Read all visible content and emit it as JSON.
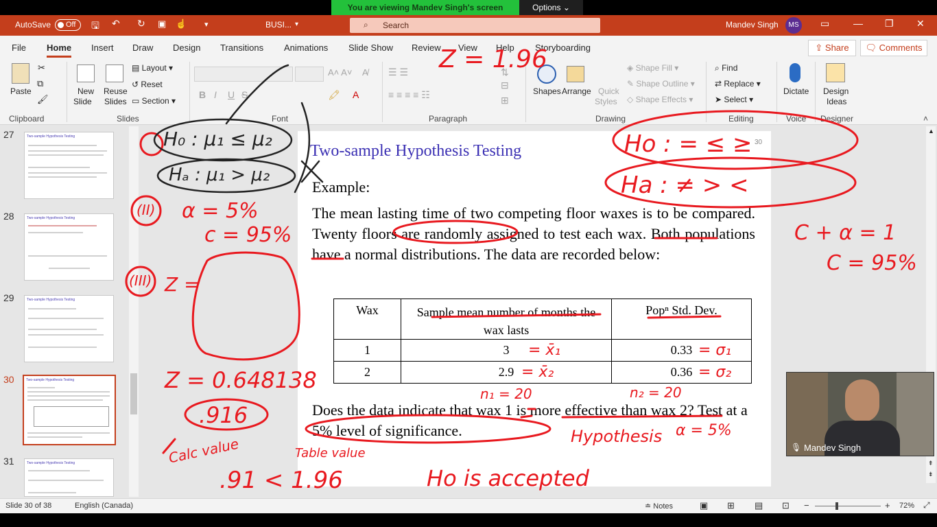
{
  "zoom": {
    "viewing_text": "You are viewing Mandev Singh's screen",
    "options_label": "Options"
  },
  "titlebar": {
    "autosave_label": "AutoSave",
    "autosave_state": "Off",
    "filename": "BUSI...",
    "search_placeholder": "Search",
    "user_name": "Mandev Singh",
    "user_initials": "MS"
  },
  "menu": {
    "tabs": [
      "File",
      "Home",
      "Insert",
      "Draw",
      "Design",
      "Transitions",
      "Animations",
      "Slide Show",
      "Review",
      "View",
      "Help",
      "Storyboarding"
    ],
    "share_label": "Share",
    "comments_label": "Comments"
  },
  "ribbon": {
    "clipboard": {
      "paste": "Paste",
      "group": "Clipboard"
    },
    "slides": {
      "new_slide_1": "New",
      "new_slide_2": "Slide",
      "reuse_1": "Reuse",
      "reuse_2": "Slides",
      "layout": "Layout",
      "reset": "Reset",
      "section": "Section",
      "group": "Slides"
    },
    "font": {
      "group": "Font",
      "bold": "B",
      "italic": "I",
      "underline": "U",
      "strike": "S"
    },
    "paragraph": {
      "group": "Paragraph"
    },
    "drawing": {
      "shapes": "Shapes",
      "arrange": "Arrange",
      "quick_1": "Quick",
      "quick_2": "Styles",
      "shape_fill": "Shape Fill",
      "shape_outline": "Shape Outline",
      "shape_effects": "Shape Effects",
      "group": "Drawing"
    },
    "editing": {
      "find": "Find",
      "replace": "Replace",
      "select": "Select",
      "group": "Editing"
    },
    "voice": {
      "dictate": "Dictate",
      "group": "Voice"
    },
    "designer": {
      "ideas_1": "Design",
      "ideas_2": "Ideas",
      "group": "Designer"
    }
  },
  "thumbnails": [
    {
      "num": "27",
      "title": "Two-sample Hypothesis Testing"
    },
    {
      "num": "28",
      "title": "Two-sample Hypothesis Testing"
    },
    {
      "num": "29",
      "title": "Two-sample Hypothesis Testing"
    },
    {
      "num": "30",
      "title": "Two-sample Hypothesis Testing"
    },
    {
      "num": "31",
      "title": "Two-sample Hypothesis Testing"
    }
  ],
  "slide": {
    "number": "30",
    "title": "Two-sample Hypothesis Testing",
    "example_label": "Example:",
    "paragraph": "The mean lasting time of two competing floor waxes is to be compared. Twenty floors are randomly assigned to test each wax. Both populations have a normal distributions. The data are recorded below:",
    "table": {
      "headers": [
        "Wax",
        "Sample mean number of months the wax lasts",
        "Popⁿ Std. Dev."
      ],
      "rows": [
        [
          "1",
          "3",
          "0.33"
        ],
        [
          "2",
          "2.9",
          "0.36"
        ]
      ]
    },
    "question": "Does the data indicate that wax 1 is more effective than wax 2? Test at a 5% level of significance."
  },
  "ink": {
    "z_196": "Z = 1.96",
    "h0": "H₀ : μ₁ ≤ μ₂",
    "ha": "Hₐ : μ₁ > μ₂",
    "step2": "(II)",
    "step3": "(III)",
    "alpha": "α = 5%",
    "conf": "c = 95%",
    "z_formula": "Z =",
    "z_value": "Z = 0.648138",
    "z_round": ".916",
    "calc_value_label": "Calc value",
    "calc_compare": ".91 < 1.96",
    "table_value_label": "Table value",
    "ho_accepted": "Ho is accepted",
    "right_ho": "Ho : = ≤ ≥",
    "right_ha": "Ha : ≠ > <",
    "c_alpha": "C + α = 1",
    "c_95": "C = 95%",
    "n1": "n₁ = 20",
    "n2": "n₂ = 20",
    "hypothesis": "Hypothesis",
    "alpha_right": "α = 5%",
    "x1": "= x̄₁",
    "x2": "= x̄₂",
    "s1": "= σ₁",
    "s2": "= σ₂"
  },
  "webcam": {
    "name": "Mandev Singh"
  },
  "status": {
    "slide_of": "Slide 30 of 38",
    "language": "English (Canada)",
    "notes": "Notes",
    "zoom": "72%"
  }
}
